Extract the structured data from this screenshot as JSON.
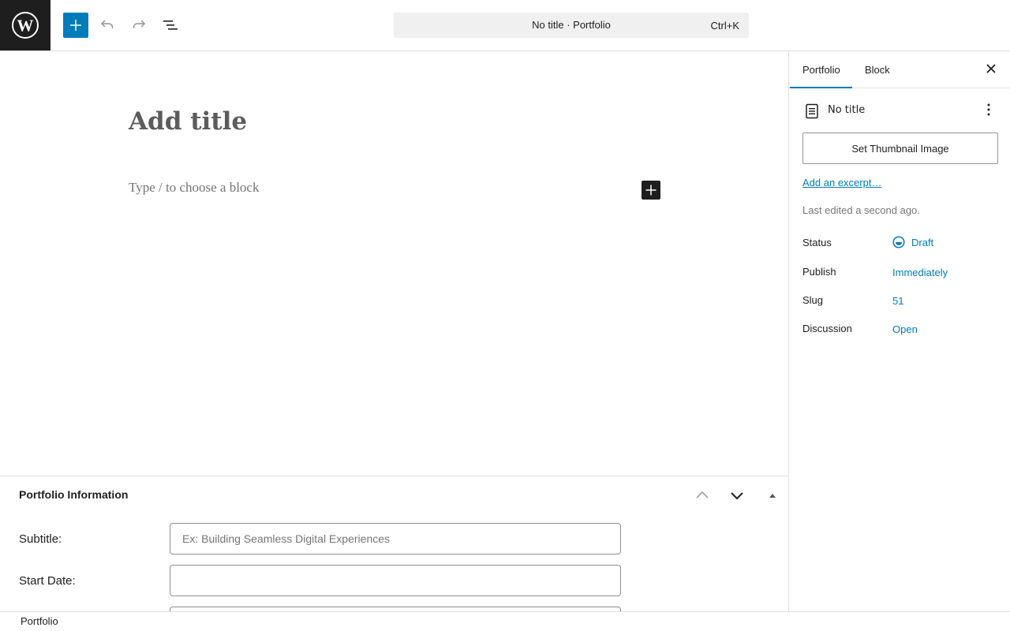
{
  "header": {
    "add_block_icon": "plus-icon",
    "undo_icon": "undo-icon",
    "redo_icon": "redo-icon",
    "list_view_icon": "list-view-icon",
    "command_title": "No title · Portfolio",
    "command_shortcut": "Ctrl+K"
  },
  "editor": {
    "title_placeholder": "Add title",
    "block_placeholder": "Type / to choose a block"
  },
  "metabox": {
    "title": "Portfolio Information",
    "fields": [
      {
        "label": "Subtitle:",
        "placeholder": "Ex: Building Seamless Digital Experiences",
        "value": ""
      },
      {
        "label": "Start Date:",
        "placeholder": "",
        "value": ""
      }
    ]
  },
  "sidebar": {
    "tabs": [
      {
        "label": "Portfolio",
        "active": true
      },
      {
        "label": "Block",
        "active": false
      }
    ],
    "document_title": "No title",
    "thumbnail_button": "Set Thumbnail Image",
    "excerpt_link": "Add an excerpt…",
    "last_edited": "Last edited a second ago.",
    "rows": [
      {
        "label": "Status",
        "value": "Draft"
      },
      {
        "label": "Publish",
        "value": "Immediately"
      },
      {
        "label": "Slug",
        "value": "51"
      },
      {
        "label": "Discussion",
        "value": "Open"
      }
    ]
  },
  "footer": {
    "breadcrumb": "Portfolio"
  },
  "colors": {
    "accent": "#007cba",
    "dark": "#1e1e1e",
    "muted": "#757575",
    "border": "#e0e0e0"
  }
}
